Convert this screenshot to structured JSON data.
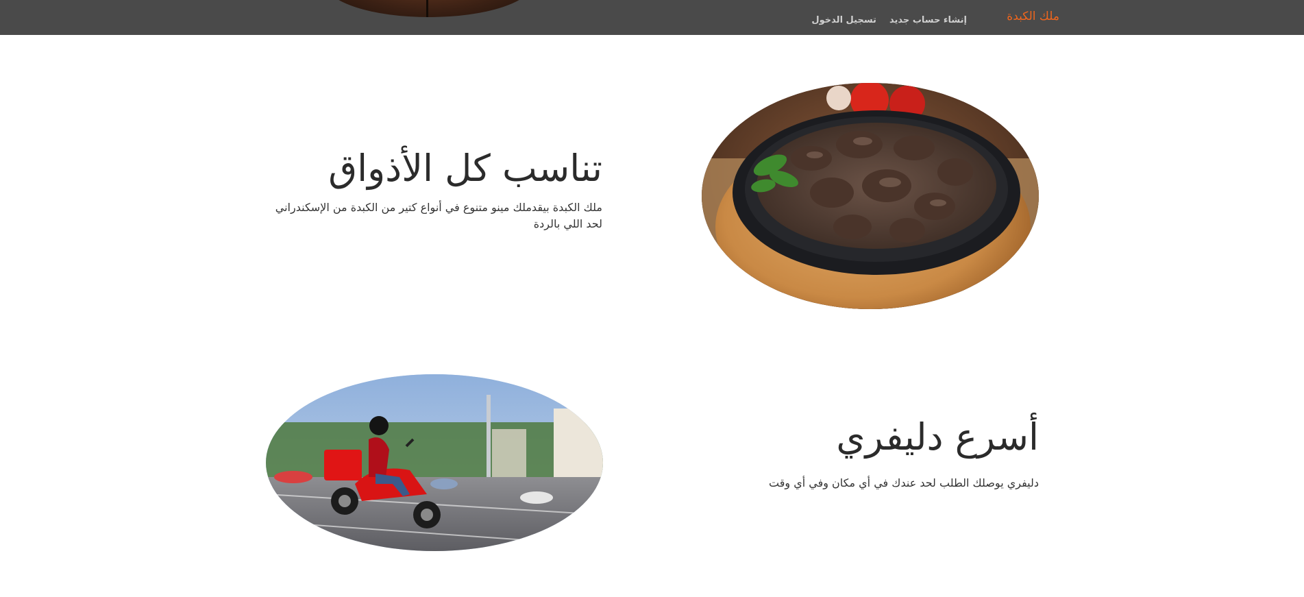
{
  "navbar": {
    "brand": "ملك الكبدة",
    "links": [
      {
        "label": "إنشاء حساب جديد"
      },
      {
        "label": "تسجيل الدخول"
      }
    ]
  },
  "features": [
    {
      "heading": "تناسب كل الأذواق",
      "text": "ملك الكبدة بيقدملك مينو متنوع في أنواع كتير من الكبدة من الإسكندراني لحد اللي بالردة",
      "image": "liver-dish-photo"
    },
    {
      "heading": "أسرع دليفري",
      "text": "دليفري يوصلك الطلب لحد عندك في أي مكان وفي أي وقت",
      "image": "delivery-scooter-photo"
    }
  ],
  "colors": {
    "navbar_bg": "#4a4a4a",
    "brand": "#f0661d",
    "nav_link": "#d0d0d0"
  }
}
